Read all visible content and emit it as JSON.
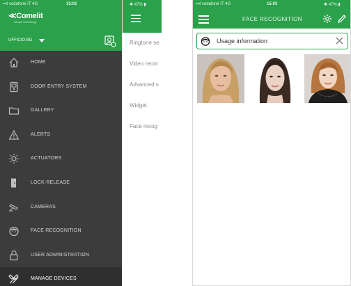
{
  "left_phone": {
    "status": {
      "carrier": "▪▪ıl vodafone IT  4G",
      "time": "15:02"
    },
    "brand": {
      "name": "Comelit",
      "tagline": "Simple technology"
    },
    "site": {
      "name": "UFFICIO BG"
    },
    "menu": [
      {
        "label": "HOME",
        "icon": "home-icon"
      },
      {
        "label": "DOOR ENTRY SYSTEM",
        "icon": "door-entry-icon"
      },
      {
        "label": "GALLERY",
        "icon": "folder-icon"
      },
      {
        "label": "ALERTS",
        "icon": "warning-icon"
      },
      {
        "label": "ACTUATORS",
        "icon": "actuators-icon"
      },
      {
        "label": "LOCK-RELEASE",
        "icon": "lock-release-icon"
      },
      {
        "label": "CAMERAS",
        "icon": "camera-icon"
      },
      {
        "label": "FACE RECOGNITION",
        "icon": "face-icon"
      },
      {
        "label": "USER ADMINISTRATION",
        "icon": "user-lock-icon"
      },
      {
        "label": "MANAGE DEVICES",
        "icon": "tools-icon",
        "active": true
      }
    ],
    "behind_screen": {
      "status_battery": "✱ 47% ▮",
      "items": [
        "Ringtone se",
        "Video recor",
        "Advanced s",
        "Widget",
        "Face recog"
      ]
    }
  },
  "right_phone": {
    "status": {
      "carrier": "▪▪ıl vodafone IT  4G",
      "time": "15:03",
      "battery": "✱ 47% ▮"
    },
    "title": "FACE RECOGNITION",
    "usage_info": "Usage information",
    "faces": [
      "face-1",
      "face-2",
      "face-3"
    ]
  },
  "colors": {
    "accent": "#2aa14a",
    "drawer": "#3c3c3c",
    "drawer_active": "#2f2f2f"
  }
}
